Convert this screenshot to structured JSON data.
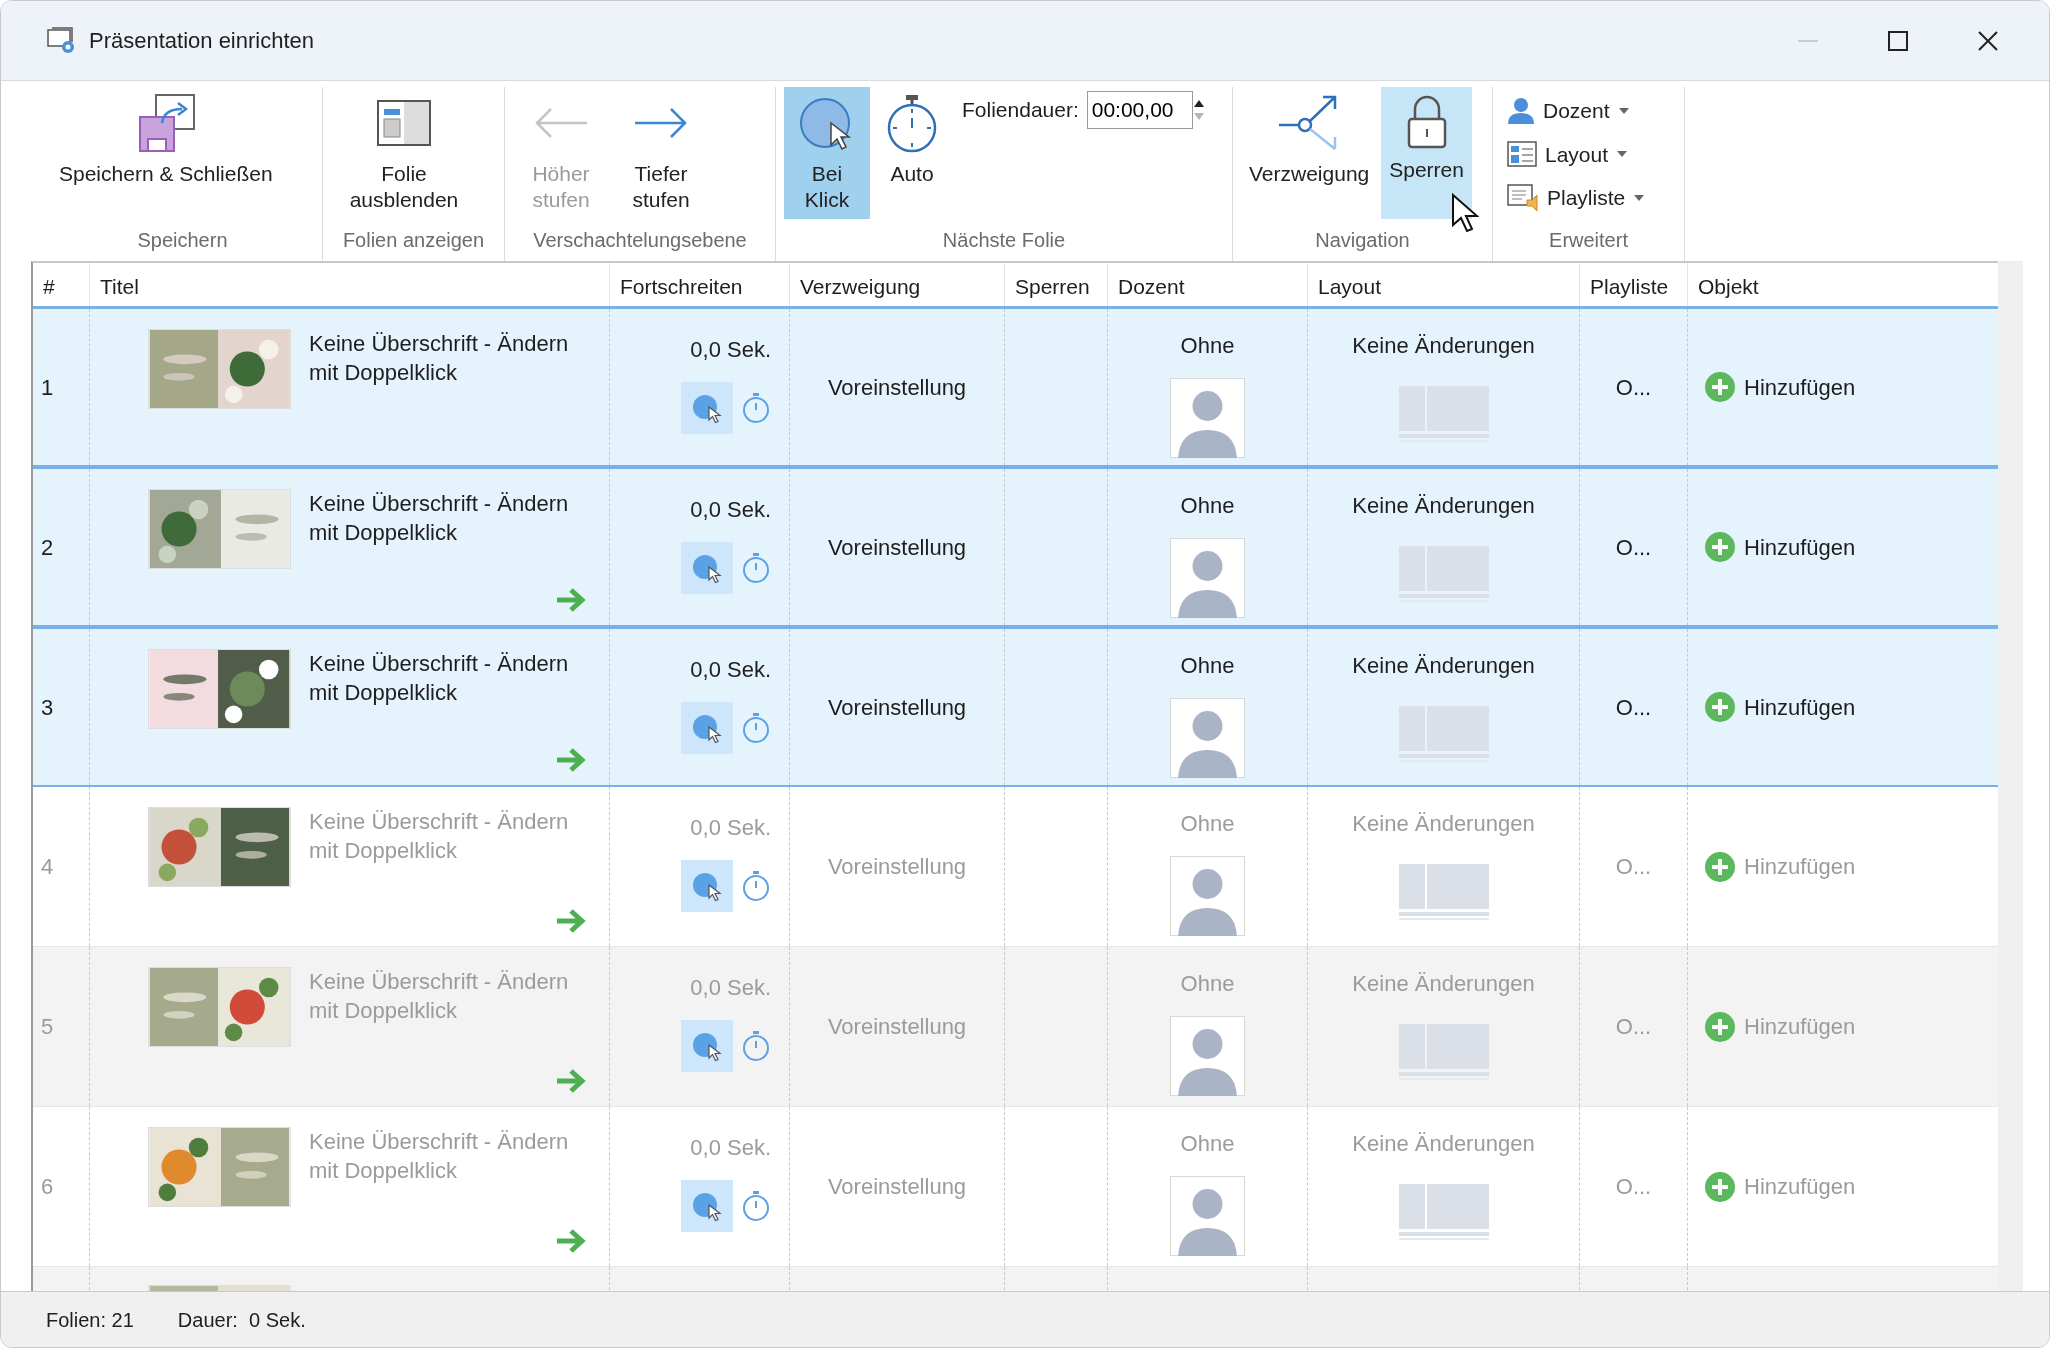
{
  "window": {
    "title": "Präsentation einrichten",
    "controls": [
      {
        "kind": "minimize",
        "disabled": true
      },
      {
        "kind": "maximize",
        "disabled": false
      },
      {
        "kind": "close",
        "disabled": false
      }
    ]
  },
  "ribbon": [
    {
      "label": "Speichern",
      "items": [
        {
          "kind": "save",
          "label": "Speichern & Schließen",
          "disabled": false,
          "selected": false,
          "hovered": false
        }
      ]
    },
    {
      "label": "Folien anzeigen",
      "items": [
        {
          "kind": "hide",
          "label": "Folie ausblenden",
          "disabled": false,
          "selected": false,
          "hovered": false
        }
      ]
    },
    {
      "label": "Verschachtelungsebene",
      "items": [
        {
          "kind": "up",
          "label": "Höher stufen",
          "disabled": true,
          "selected": false,
          "hovered": false
        },
        {
          "kind": "down",
          "label": "Tiefer stufen",
          "disabled": false,
          "selected": false,
          "hovered": false
        }
      ]
    },
    {
      "label": "Nächste Folie",
      "items": [
        {
          "kind": "click",
          "label": "Bei Klick",
          "disabled": false,
          "selected": true,
          "hovered": false
        },
        {
          "kind": "auto",
          "label": "Auto",
          "disabled": false,
          "selected": false,
          "hovered": false
        },
        {
          "kind": "duration",
          "label": "Foliendauer:",
          "value": "00:00,00"
        }
      ]
    },
    {
      "label": "Navigation",
      "items": [
        {
          "kind": "branch",
          "label": "Verzweigung",
          "disabled": false,
          "selected": false,
          "hovered": false
        },
        {
          "kind": "lock",
          "label": "Sperren",
          "disabled": false,
          "selected": false,
          "hovered": true
        }
      ]
    },
    {
      "label": "Erweitert",
      "items": [
        {
          "kind": "presenter",
          "label": "Dozent"
        },
        {
          "kind": "layout",
          "label": "Layout"
        },
        {
          "kind": "playlist",
          "label": "Playliste"
        }
      ]
    }
  ],
  "table": {
    "columns": [
      "#",
      "Titel",
      "Fortschreiten",
      "Verzweigung",
      "Sperren",
      "Dozent",
      "Layout",
      "Playliste",
      "Objekt"
    ],
    "rows": [
      {
        "number": "1",
        "title": "Keine Überschrift - Ändern mit Doppelklick",
        "nested": false,
        "duration": "0,0 Sek.",
        "on_click": true,
        "branch": "Voreinstellung",
        "presenter": "Ohne",
        "layout": "Keine Änderungen",
        "playlist": "O...",
        "object": "Hinzufügen",
        "selected": true,
        "dimmed": false,
        "shaded": false
      },
      {
        "number": "2",
        "title": "Keine Überschrift - Ändern mit Doppelklick",
        "nested": true,
        "duration": "0,0 Sek.",
        "on_click": true,
        "branch": "Voreinstellung",
        "presenter": "Ohne",
        "layout": "Keine Änderungen",
        "playlist": "O...",
        "object": "Hinzufügen",
        "selected": true,
        "dimmed": false,
        "shaded": false
      },
      {
        "number": "3",
        "title": "Keine Überschrift - Ändern mit Doppelklick",
        "nested": true,
        "duration": "0,0 Sek.",
        "on_click": true,
        "branch": "Voreinstellung",
        "presenter": "Ohne",
        "layout": "Keine Änderungen",
        "playlist": "O...",
        "object": "Hinzufügen",
        "selected": true,
        "dimmed": false,
        "shaded": false
      },
      {
        "number": "4",
        "title": "Keine Überschrift - Ändern mit Doppelklick",
        "nested": true,
        "duration": "0,0 Sek.",
        "on_click": true,
        "branch": "Voreinstellung",
        "presenter": "Ohne",
        "layout": "Keine Änderungen",
        "playlist": "O...",
        "object": "Hinzufügen",
        "selected": false,
        "dimmed": true,
        "shaded": false
      },
      {
        "number": "5",
        "title": "Keine Überschrift - Ändern mit Doppelklick",
        "nested": true,
        "duration": "0,0 Sek.",
        "on_click": true,
        "branch": "Voreinstellung",
        "presenter": "Ohne",
        "layout": "Keine Änderungen",
        "playlist": "O...",
        "object": "Hinzufügen",
        "selected": false,
        "dimmed": true,
        "shaded": true
      },
      {
        "number": "6",
        "title": "Keine Überschrift - Ändern mit Doppelklick",
        "nested": true,
        "duration": "0,0 Sek.",
        "on_click": true,
        "branch": "Voreinstellung",
        "presenter": "Ohne",
        "layout": "Keine Änderungen",
        "playlist": "O...",
        "object": "Hinzufügen",
        "selected": false,
        "dimmed": true,
        "shaded": false
      },
      {
        "cut": true,
        "shaded": true
      }
    ]
  },
  "status_bar": {
    "slides": "Folien: 21",
    "duration": "Dauer:  0 Sek."
  }
}
